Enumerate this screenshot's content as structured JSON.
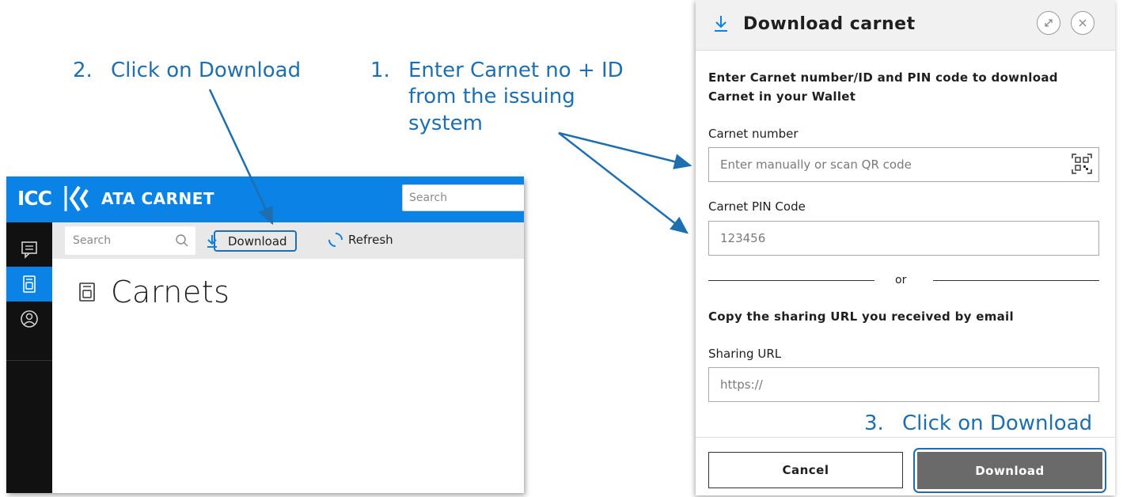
{
  "annotations": {
    "step1_num": "1.",
    "step1_line1": "Enter Carnet no + ID",
    "step1_line2": "from the issuing",
    "step1_line3": "system",
    "step2_num": "2.",
    "step2_text": "Click on Download",
    "step3_num": "3.",
    "step3_text": "Click on Download"
  },
  "app": {
    "logo": "ICC",
    "title": "ATA CARNET",
    "header_search_placeholder": "Search",
    "nav_icons": [
      "chat-icon",
      "carnet-icon",
      "user-icon"
    ],
    "toolbar": {
      "search_placeholder": "Search",
      "download_label": "Download",
      "refresh_label": "Refresh"
    },
    "page_title": "Carnets"
  },
  "dialog": {
    "title": "Download carnet",
    "instruction": "Enter Carnet number/ID and PIN code to download Carnet in your Wallet",
    "carnet_number_label": "Carnet number",
    "carnet_number_placeholder": "Enter manually or scan QR code",
    "pin_label": "Carnet PIN Code",
    "pin_value": "123456",
    "or_text": "or",
    "url_instruction": "Copy the sharing URL you received by email",
    "url_label": "Sharing URL",
    "url_value": "https://",
    "cancel_label": "Cancel",
    "download_label": "Download"
  },
  "colors": {
    "brand_blue": "#0a82e6",
    "annotation_blue": "#1f6fb0",
    "download_button_bg": "#6a6a6a"
  }
}
